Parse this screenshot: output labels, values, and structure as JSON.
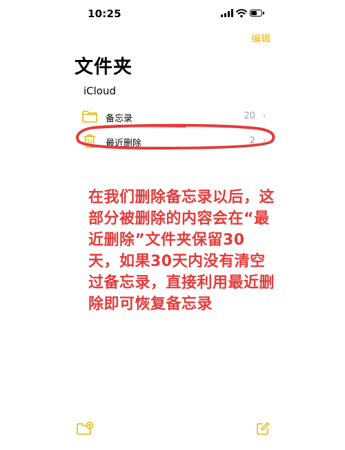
{
  "status_bar": {
    "time": "10:25",
    "battery_level": 0.6
  },
  "nav": {
    "edit_label": "编辑"
  },
  "page": {
    "title": "文件夹",
    "section": "iCloud"
  },
  "folders": [
    {
      "label": "备忘录",
      "count": "20",
      "icon": "folder-icon"
    },
    {
      "label": "最近删除",
      "count": "2",
      "icon": "trash-icon"
    }
  ],
  "annotation": {
    "text": "在我们删除备忘录以后，这部分被删除的内容会在“最近删除”文件夹保留30天，如果30天内没有清空过备忘录，直接利用最近删除即可恢复备忘录"
  },
  "colors": {
    "accent": "#e6b800",
    "annotation": "#e53a3a"
  },
  "toolbar": {
    "left_icon": "new-folder-icon",
    "right_icon": "compose-icon"
  }
}
